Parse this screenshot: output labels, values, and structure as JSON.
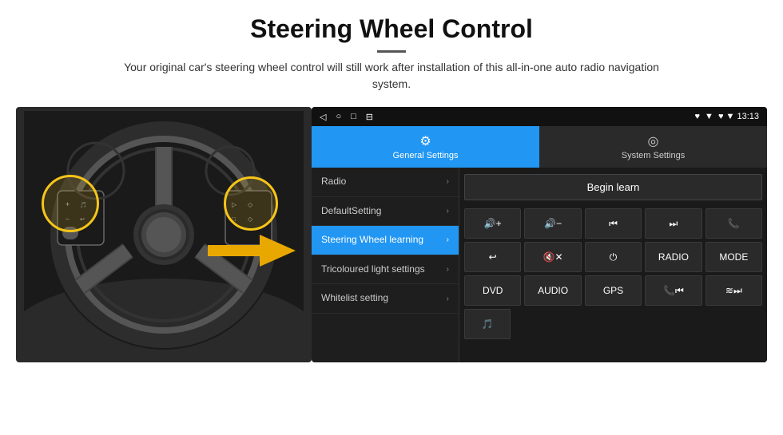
{
  "header": {
    "title": "Steering Wheel Control",
    "divider": true,
    "subtitle": "Your original car's steering wheel control will still work after installation of this all-in-one auto radio navigation system."
  },
  "android_screen": {
    "status_bar": {
      "icons": [
        "◁",
        "○",
        "□",
        "⊟"
      ],
      "right_info": "♥ ▼ 13:13"
    },
    "tabs": [
      {
        "id": "general",
        "label": "General Settings",
        "icon": "⚙",
        "active": true
      },
      {
        "id": "system",
        "label": "System Settings",
        "icon": "◎",
        "active": false
      }
    ],
    "menu_items": [
      {
        "id": "radio",
        "label": "Radio",
        "active": false
      },
      {
        "id": "default-setting",
        "label": "DefaultSetting",
        "active": false
      },
      {
        "id": "steering-wheel",
        "label": "Steering Wheel learning",
        "active": true
      },
      {
        "id": "tricoloured",
        "label": "Tricoloured light settings",
        "active": false
      },
      {
        "id": "whitelist",
        "label": "Whitelist setting",
        "active": false
      }
    ],
    "begin_learn_label": "Begin learn",
    "control_rows": [
      [
        {
          "label": "🔊+",
          "id": "vol-up"
        },
        {
          "label": "🔊−",
          "id": "vol-down"
        },
        {
          "label": "⏮",
          "id": "prev"
        },
        {
          "label": "⏭",
          "id": "next"
        },
        {
          "label": "📞",
          "id": "phone"
        }
      ],
      [
        {
          "label": "↩",
          "id": "hangup"
        },
        {
          "label": "🔇✕",
          "id": "mute"
        },
        {
          "label": "⏻",
          "id": "power"
        },
        {
          "label": "RADIO",
          "id": "radio-btn"
        },
        {
          "label": "MODE",
          "id": "mode"
        }
      ],
      [
        {
          "label": "DVD",
          "id": "dvd"
        },
        {
          "label": "AUDIO",
          "id": "audio"
        },
        {
          "label": "GPS",
          "id": "gps"
        },
        {
          "label": "📞⏮",
          "id": "call-prev"
        },
        {
          "label": "≋⏭",
          "id": "call-next"
        }
      ]
    ],
    "bottom_row": [
      {
        "label": "🎵",
        "id": "music"
      }
    ]
  }
}
